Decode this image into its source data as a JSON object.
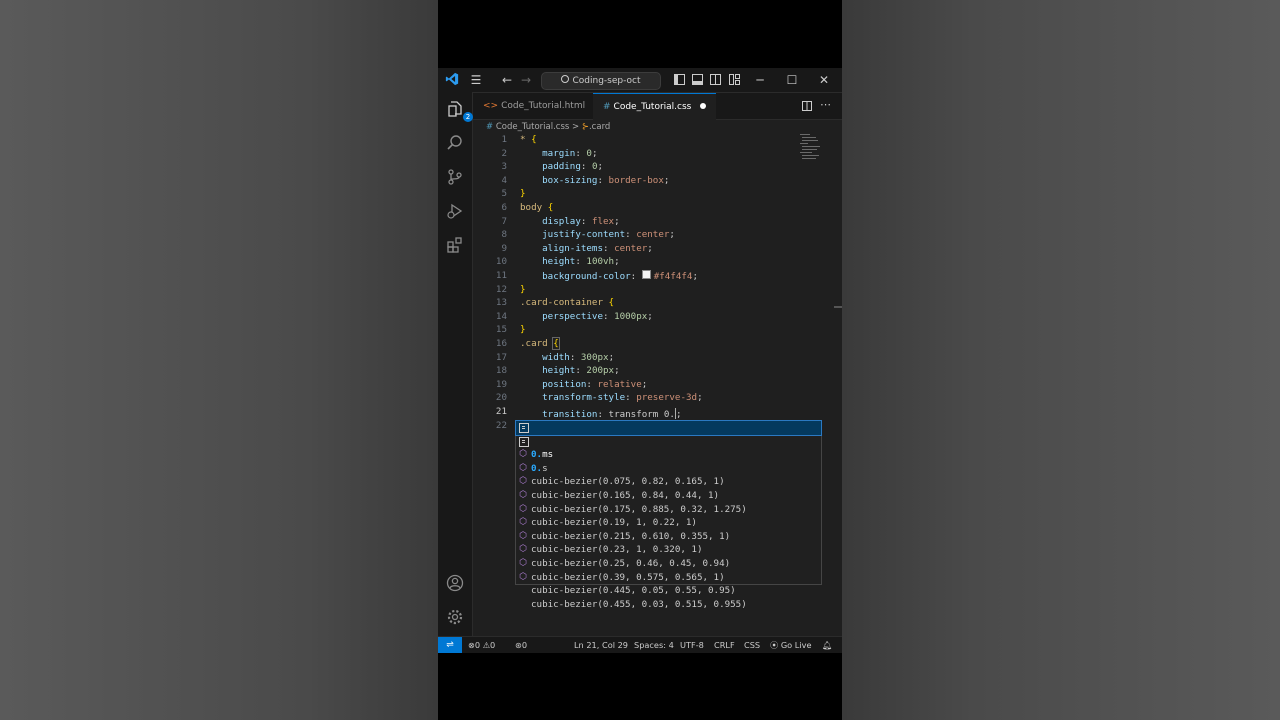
{
  "search": {
    "text": "Coding-sep-oct"
  },
  "activity_badge": "2",
  "tabs": [
    {
      "label": "Code_Tutorial.html",
      "icon": "code-brackets-icon"
    },
    {
      "label": "Code_Tutorial.css",
      "icon": "hash-icon"
    }
  ],
  "breadcrumb": {
    "file": "Code_Tutorial.css",
    "symbol": ".card"
  },
  "line_numbers": [
    "1",
    "2",
    "3",
    "4",
    "5",
    "6",
    "7",
    "8",
    "9",
    "10",
    "11",
    "12",
    "13",
    "14",
    "15",
    "16",
    "17",
    "18",
    "19",
    "20",
    "21",
    "22"
  ],
  "code": {
    "l1_sel": "*",
    "l1_brace": "{",
    "l2_prop": "margin",
    "l2_val": "0",
    "l3_prop": "padding",
    "l3_val": "0",
    "l4_prop": "box-sizing",
    "l4_val": "border-box",
    "l5_brace": "}",
    "l6_sel": "body",
    "l6_brace": "{",
    "l7_prop": "display",
    "l7_val": "flex",
    "l8_prop": "justify-content",
    "l8_val": "center",
    "l9_prop": "align-items",
    "l9_val": "center",
    "l10_prop": "height",
    "l10_val": "100vh",
    "l11_prop": "background-color",
    "l11_val": "#f4f4f4",
    "l12_brace": "}",
    "l13_sel": ".card-container",
    "l13_brace": "{",
    "l14_prop": "perspective",
    "l14_val": "1000px",
    "l15_brace": "}",
    "l16_sel": ".card",
    "l16_brace": "{",
    "l17_prop": "width",
    "l17_val": "300px",
    "l18_prop": "height",
    "l18_val": "200px",
    "l19_prop": "position",
    "l19_val": "relative",
    "l20_prop": "transform-style",
    "l20_val": "preserve-3d",
    "l21_prop": "transition",
    "l21_val": "transform 0."
  },
  "suggestions": [
    {
      "match": "0.",
      "rest": "ms",
      "kind": "keyword"
    },
    {
      "match": "0.",
      "rest": "s",
      "kind": "keyword"
    },
    {
      "match": "",
      "pre": "cubic-bezier(",
      "rest": "0.075, 0.82, 0.165, 1)",
      "kind": "function"
    },
    {
      "pre": "cubic-bezier(",
      "rest": "0.165, 0.84, 0.44, 1)",
      "kind": "function"
    },
    {
      "pre": "cubic-bezier(",
      "rest": "0.175, 0.885, 0.32, 1.275)",
      "kind": "function"
    },
    {
      "pre": "cubic-bezier(",
      "rest": "0.19, 1, 0.22, 1)",
      "kind": "function"
    },
    {
      "pre": "cubic-bezier(",
      "rest": "0.215, 0.610, 0.355, 1)",
      "kind": "function"
    },
    {
      "pre": "cubic-bezier(",
      "rest": "0.23, 1, 0.320, 1)",
      "kind": "function"
    },
    {
      "pre": "cubic-bezier(",
      "rest": "0.25, 0.46, 0.45, 0.94)",
      "kind": "function"
    },
    {
      "pre": "cubic-bezier(",
      "rest": "0.39, 0.575, 0.565, 1)",
      "kind": "function"
    },
    {
      "pre": "cubic-bezier(",
      "rest": "0.445, 0.05, 0.55, 0.95)",
      "kind": "function"
    },
    {
      "pre": "cubic-bezier(",
      "rest": "0.455, 0.03, 0.515, 0.955)",
      "kind": "function"
    }
  ],
  "status": {
    "errors": "0",
    "warnings": "0",
    "ports": "0",
    "position": "Ln 21, Col 29",
    "spaces": "Spaces: 4",
    "encoding": "UTF-8",
    "eol": "CRLF",
    "language": "CSS",
    "golive": "Go Live"
  },
  "colors": {
    "accent": "#0078d4",
    "editor_bg": "#1f1f1f",
    "selector": "#d7ba7d",
    "property": "#9cdcfe",
    "value": "#ce9178"
  }
}
